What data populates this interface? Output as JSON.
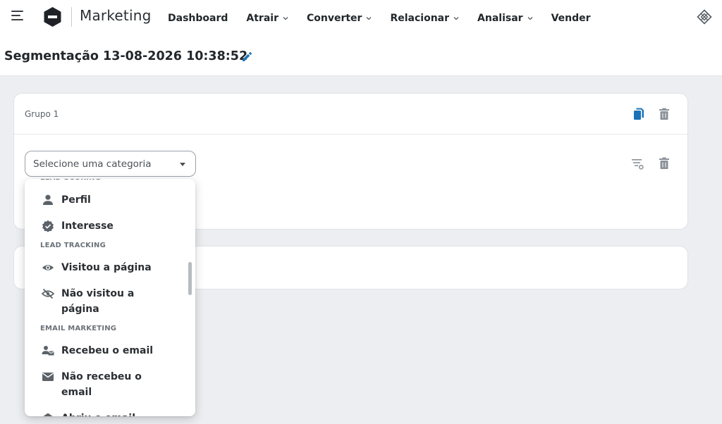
{
  "header": {
    "app_title": "Marketing",
    "nav": [
      {
        "label": "Dashboard",
        "has_dropdown": false
      },
      {
        "label": "Atrair",
        "has_dropdown": true
      },
      {
        "label": "Converter",
        "has_dropdown": true
      },
      {
        "label": "Relacionar",
        "has_dropdown": true
      },
      {
        "label": "Analisar",
        "has_dropdown": true
      },
      {
        "label": "Vender",
        "has_dropdown": false
      }
    ]
  },
  "page": {
    "title": "Segmentação 13-08-2026 10:38:52"
  },
  "group": {
    "label": "Grupo 1",
    "select_placeholder": "Selecione uma categoria"
  },
  "dropdown": {
    "sections": [
      {
        "title": "LEAD SCORING",
        "items": [
          {
            "label": "Perfil",
            "icon": "person-icon"
          },
          {
            "label": "Interesse",
            "icon": "verified-badge-icon"
          }
        ]
      },
      {
        "title": "LEAD TRACKING",
        "items": [
          {
            "label": "Visitou a página",
            "icon": "eye-icon"
          },
          {
            "label": "Não visitou a página",
            "icon": "eye-off-icon"
          }
        ]
      },
      {
        "title": "EMAIL MARKETING",
        "items": [
          {
            "label": "Recebeu o email",
            "icon": "person-mail-icon"
          },
          {
            "label": "Não recebeu o email",
            "icon": "mail-icon"
          },
          {
            "label": "Abriu o email",
            "icon": "mail-open-icon"
          }
        ]
      }
    ]
  },
  "colors": {
    "accent": "#1a73b8",
    "text": "#22272b",
    "icon_gray": "#8a9197",
    "background": "#eceef1"
  }
}
